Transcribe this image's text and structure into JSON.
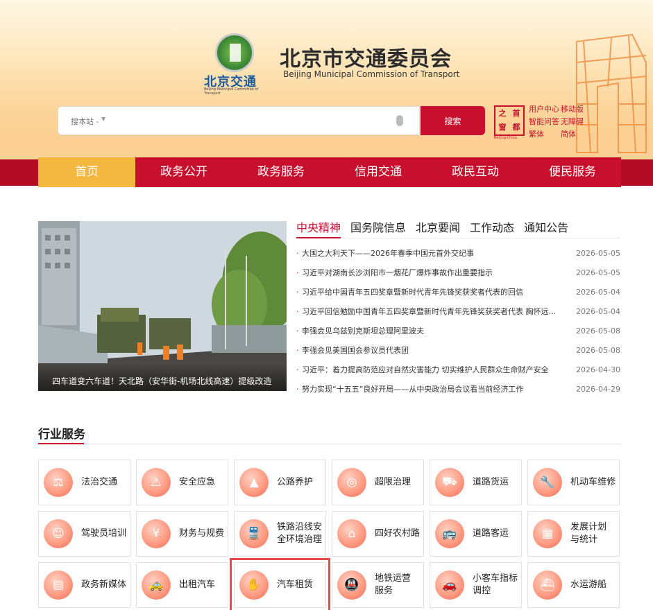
{
  "header": {
    "logo_cn": "北京交通",
    "logo_en": "Beijing Municipal Committee of Transport",
    "title": "北京市交通委员会",
    "subtitle": "Beijing Municipal Commission of Transport",
    "search_scope": "搜本站 -",
    "search_btn": "搜索",
    "capital_chars": [
      "首",
      "都",
      "之",
      "窗"
    ],
    "capital_en": "Beijing·China",
    "quick_links": [
      "用户中心",
      "移动版",
      "智能问答",
      "无障碍",
      "繁体",
      "简体"
    ]
  },
  "nav": [
    "首页",
    "政务公开",
    "政务服务",
    "信用交通",
    "政民互动",
    "便民服务"
  ],
  "feature": {
    "caption": "四车道变六车道！天北路（安华街-机场北线高速）提级改造"
  },
  "news": {
    "tabs": [
      "中央精神",
      "国务院信息",
      "北京要闻",
      "工作动态",
      "通知公告"
    ],
    "items": [
      {
        "title": "大国之大利天下——2026年春季中国元首外交纪事",
        "date": "2026-05-05"
      },
      {
        "title": "习近平对湖南长沙浏阳市一烟花厂爆炸事故作出重要指示",
        "date": "2026-05-05"
      },
      {
        "title": "习近平给中国青年五四奖章暨新时代青年先锋奖获奖者代表的回信",
        "date": "2026-05-04"
      },
      {
        "title": "习近平回信勉励中国青年五四奖章暨新时代青年先锋奖获奖者代表 胸怀远...",
        "date": "2026-05-04"
      },
      {
        "title": "李强会见乌兹别克斯坦总理阿里波夫",
        "date": "2026-05-08"
      },
      {
        "title": "李强会见美国国会参议员代表团",
        "date": "2026-05-08"
      },
      {
        "title": "习近平：着力提高防范应对自然灾害能力 切实维护人民群众生命财产安全",
        "date": "2026-04-30"
      },
      {
        "title": "努力实现“十五五”良好开局——从中央政治局会议看当前经济工作",
        "date": "2026-04-29"
      }
    ]
  },
  "services": {
    "title": "行业服务",
    "items": [
      {
        "label": "法治交通",
        "icon": "person-law-icon"
      },
      {
        "label": "安全应急",
        "icon": "warning-doc-icon"
      },
      {
        "label": "公路养护",
        "icon": "road-cone-icon"
      },
      {
        "label": "超限治理",
        "icon": "overload-icon"
      },
      {
        "label": "道路货运",
        "icon": "truck-icon"
      },
      {
        "label": "机动车维修",
        "icon": "car-repair-icon"
      },
      {
        "label": "驾驶员培训",
        "icon": "driver-icon"
      },
      {
        "label": "财务与规费",
        "icon": "finance-icon"
      },
      {
        "label": "铁路沿线安全环境治理",
        "icon": "rail-safety-icon"
      },
      {
        "label": "四好农村路",
        "icon": "rural-road-icon"
      },
      {
        "label": "道路客运",
        "icon": "bus-icon"
      },
      {
        "label": "发展计划与统计",
        "icon": "statistics-icon"
      },
      {
        "label": "政务新媒体",
        "icon": "media-icon"
      },
      {
        "label": "出租汽车",
        "icon": "taxi-icon"
      },
      {
        "label": "汽车租赁",
        "icon": "car-rental-icon"
      },
      {
        "label": "地铁运营服务",
        "icon": "subway-icon"
      },
      {
        "label": "小客车指标调控",
        "icon": "car-quota-icon"
      },
      {
        "label": "水运游船",
        "icon": "ship-icon"
      }
    ]
  }
}
